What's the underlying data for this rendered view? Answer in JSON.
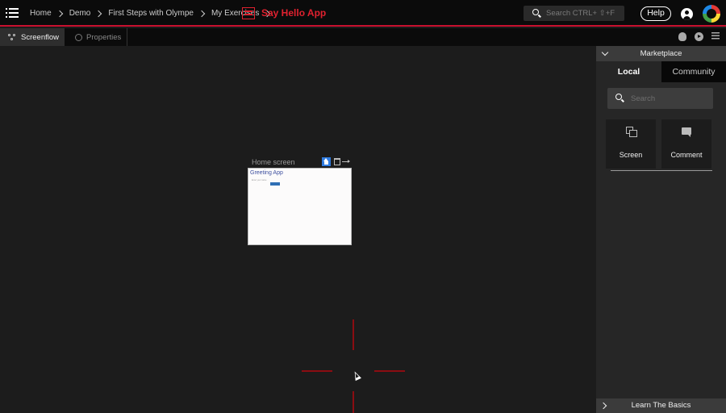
{
  "breadcrumbs": [
    "Home",
    "Demo",
    "First Steps with Olympe",
    "My Exercises"
  ],
  "app_title": "Say Hello App",
  "search": {
    "placeholder": "Search CTRL+ ⇧+F"
  },
  "header_buttons": {
    "help": "Help"
  },
  "toolbar": {
    "tabs": [
      {
        "label": "Screenflow"
      },
      {
        "label": "Properties"
      }
    ]
  },
  "canvas": {
    "screen": {
      "label": "Home screen",
      "preview_title": "Greeting App",
      "preview_field": "Enter your name"
    }
  },
  "marketplace": {
    "title": "Marketplace",
    "tabs": [
      "Local",
      "Community"
    ],
    "search_placeholder": "Search",
    "tiles": [
      "Screen",
      "Comment"
    ],
    "footer": "Learn The Basics"
  },
  "colors": {
    "accent": "#e0212f",
    "panel": "#262626",
    "canvas": "#1c1c1c"
  }
}
